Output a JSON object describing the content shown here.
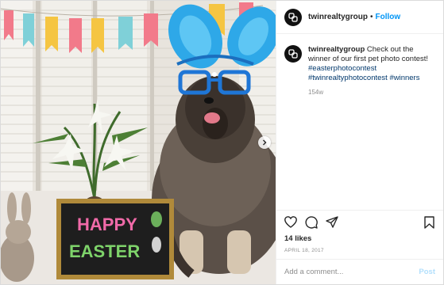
{
  "photo": {
    "sign_line1": "HAPPY",
    "sign_line2": "EASTER"
  },
  "header": {
    "username": "twinrealtygroup",
    "separator": "•",
    "follow_label": "Follow"
  },
  "caption": {
    "username": "twinrealtygroup",
    "text": "Check out the winner of our first pet photo contest!",
    "hashtags": [
      "#easterphotocontest",
      "#twinrealtyphotocontest",
      "#winners"
    ],
    "age": "154w"
  },
  "actions": {
    "icons": [
      "heart-icon",
      "comment-icon",
      "share-icon",
      "bookmark-icon"
    ]
  },
  "likes": "14 likes",
  "date": "APRIL 18, 2017",
  "comment": {
    "placeholder": "Add a comment...",
    "post_label": "Post"
  },
  "colors": {
    "link": "#00376b",
    "follow": "#0095f6",
    "post_disabled": "#b2dffc",
    "muted": "#8e8e8e"
  }
}
